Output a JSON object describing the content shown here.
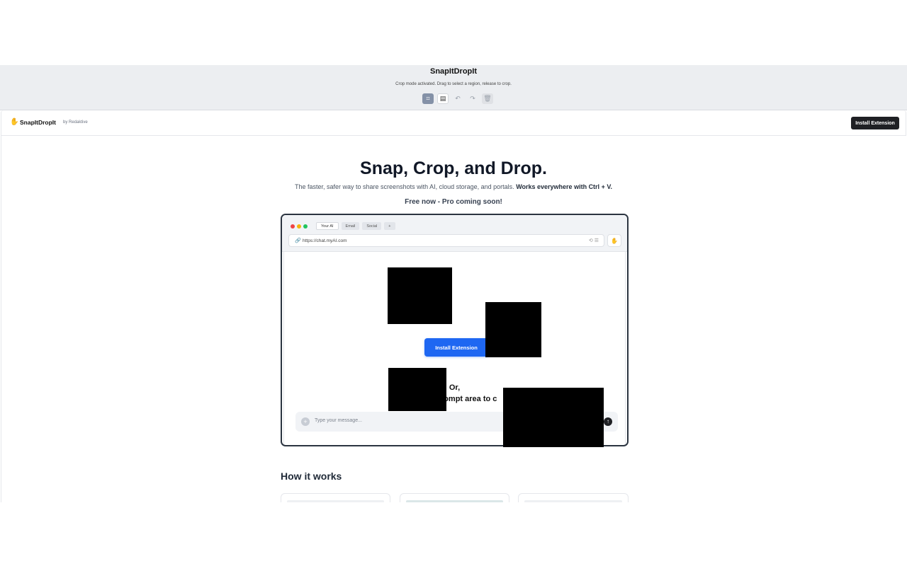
{
  "crop_bar": {
    "title": "SnapItDropIt",
    "message": "Crop mode activated. Drag to select a region, release to crop.",
    "tools": [
      {
        "icon": "crop-icon",
        "glyph": "⌗",
        "state": "active"
      },
      {
        "icon": "document-icon",
        "glyph": "▤",
        "state": "white"
      },
      {
        "icon": "undo-icon",
        "glyph": "↶",
        "state": "plain"
      },
      {
        "icon": "redo-icon",
        "glyph": "↷",
        "state": "plain"
      },
      {
        "icon": "trash-icon",
        "glyph": "🗑",
        "state": "grey"
      }
    ]
  },
  "nav": {
    "brand_icon": "✋",
    "brand_name": "SnapItDropIt",
    "brand_by": "by Redaktive",
    "install_label": "Install Extension"
  },
  "hero": {
    "title": "Snap, Crop, and Drop.",
    "subtitle": "The faster, safer way to share screenshots with AI, cloud storage, and portals.",
    "subtitle_bold": "Works everywhere with Ctrl + V.",
    "free": "Free now - Pro coming soon!"
  },
  "demo": {
    "dots": [
      "#ef4444",
      "#f5b50b",
      "#22c55e"
    ],
    "tabs": [
      "Your AI",
      "Email",
      "Social",
      "+"
    ],
    "link_glyph": "🔗",
    "url": "https://chat.myAI.com",
    "addr_icons": "⟲ ☰",
    "ext_glyph": "✋",
    "install_label": "Install Extension",
    "or_line1": "Or,",
    "or_line2": "rig          ompt area to c",
    "prompt_placeholder": "Type your message...",
    "prompt_plus": "+",
    "prompt_send": "↑"
  },
  "how_it_works": "How it works"
}
